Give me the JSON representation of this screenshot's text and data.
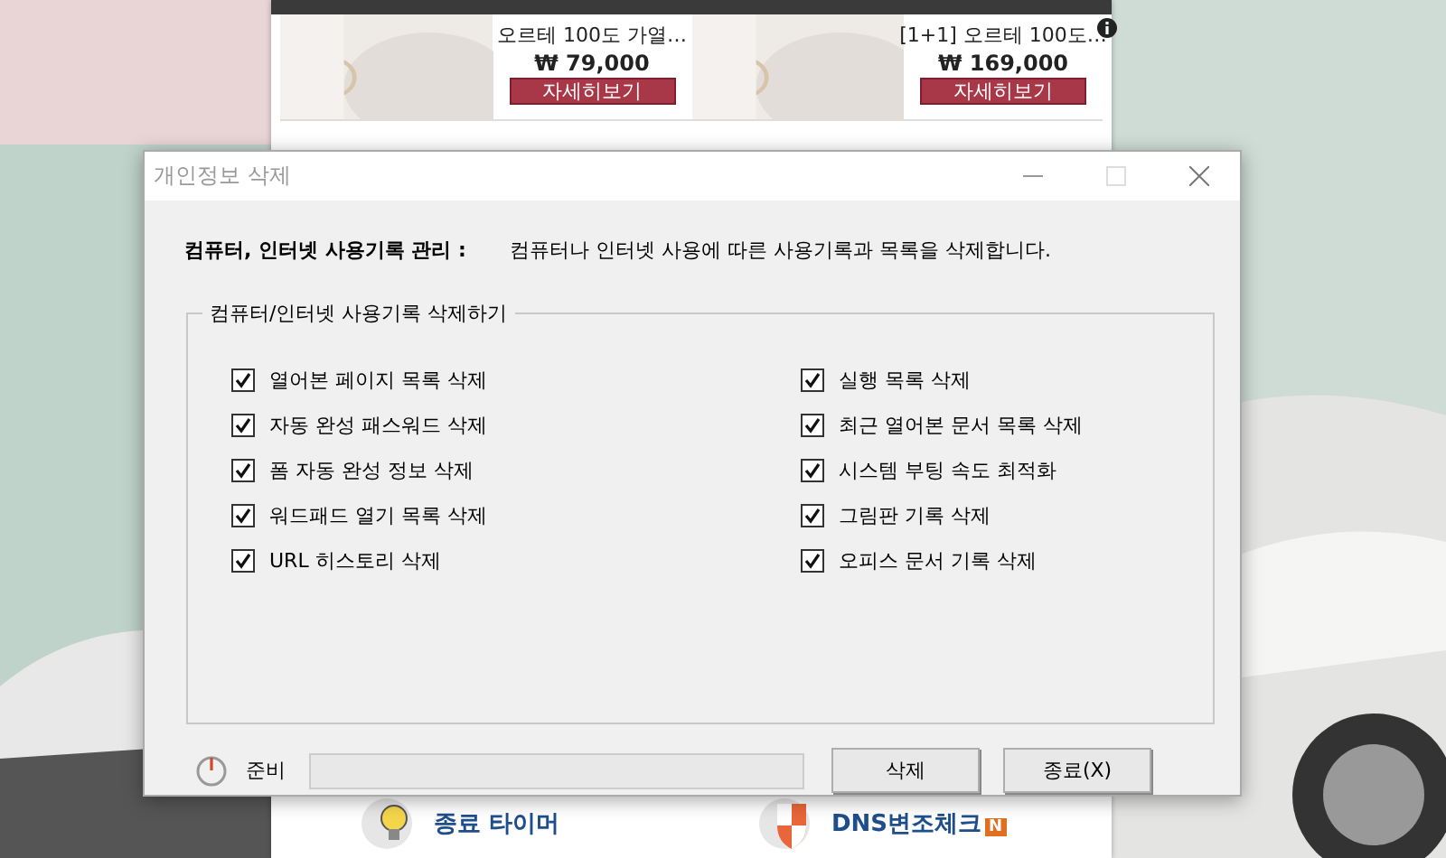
{
  "background_app": {
    "products": [
      {
        "name": "오르테 100도 가열…",
        "price": "₩ 79,000",
        "button": "자세히보기",
        "info": false
      },
      {
        "name": "[1+1] 오르테 100도…",
        "price": "₩ 169,000",
        "button": "자세히보기",
        "info": true
      }
    ],
    "tools": [
      {
        "kind": "timer",
        "label": "종료 타이머"
      },
      {
        "kind": "dns",
        "label": "DNS변조체크",
        "badge": "N"
      }
    ]
  },
  "dialog": {
    "title": "개인정보 삭제",
    "header_label": "컴퓨터, 인터넷 사용기록 관리 :",
    "header_description": "컴퓨터나 인터넷 사용에 따른 사용기록과 목록을 삭제합니다.",
    "group": {
      "title": "컴퓨터/인터넷 사용기록 삭제하기",
      "options": [
        {
          "label": "열어본 페이지 목록 삭제",
          "checked": true
        },
        {
          "label": "자동 완성 패스워드 삭제",
          "checked": true
        },
        {
          "label": "폼 자동 완성 정보 삭제",
          "checked": true
        },
        {
          "label": "워드패드 열기 목록 삭제",
          "checked": true
        },
        {
          "label": "URL 히스토리 삭제",
          "checked": true
        },
        {
          "label": "실행 목록 삭제",
          "checked": true
        },
        {
          "label": "최근 열어본 문서 목록 삭제",
          "checked": true
        },
        {
          "label": "시스템 부팅 속도 최적화",
          "checked": true
        },
        {
          "label": "그림판 기록 삭제",
          "checked": true
        },
        {
          "label": "오피스 문서 기록 삭제",
          "checked": true
        }
      ]
    },
    "status": "준비",
    "progress": {
      "level": 0
    },
    "buttons": [
      "삭제",
      "종료(X)"
    ]
  }
}
